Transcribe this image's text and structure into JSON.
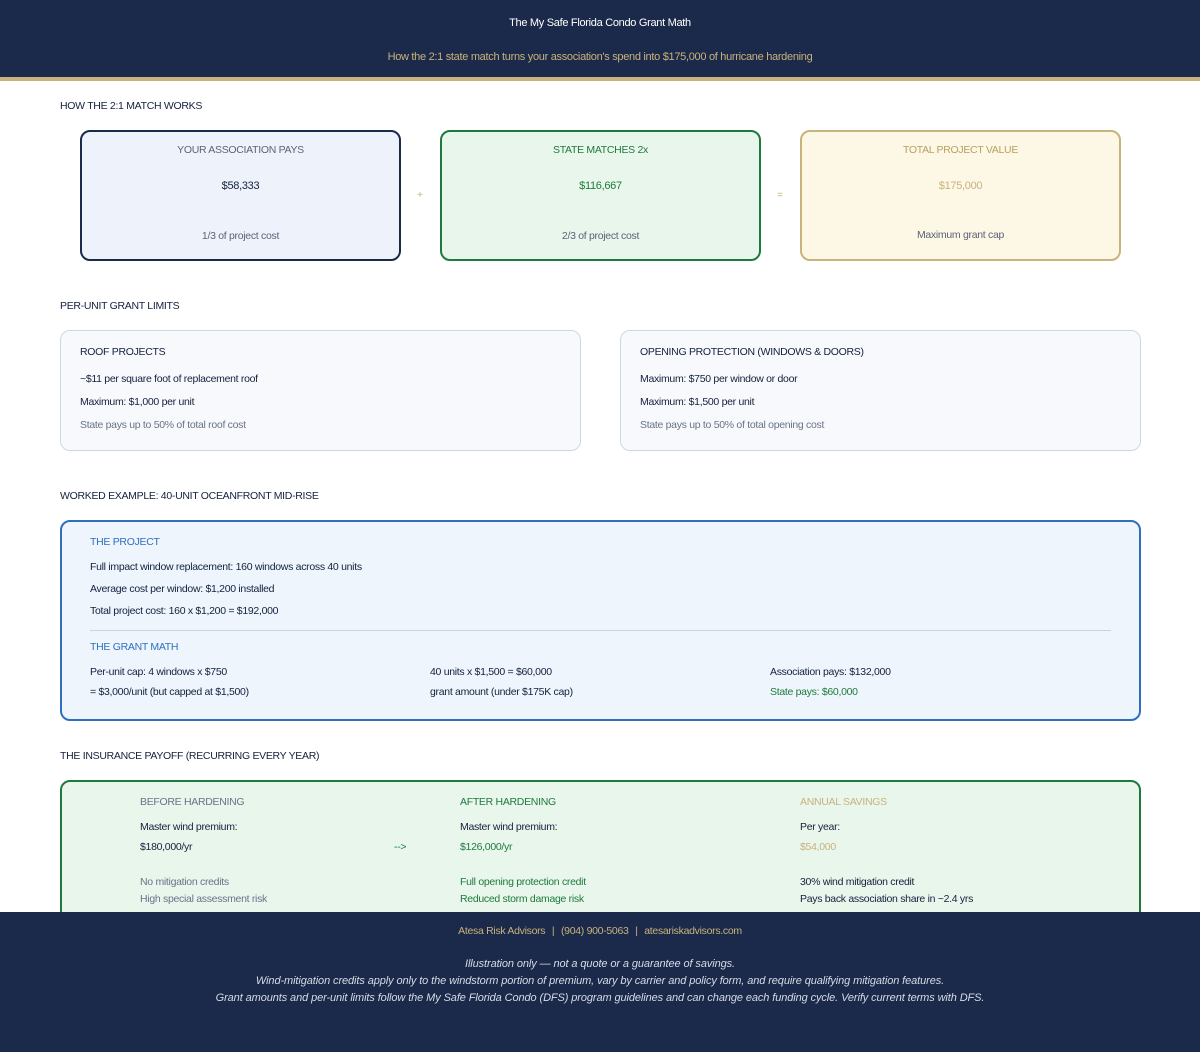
{
  "header": {
    "title": "The My Safe Florida Condo Grant Math",
    "subtitle": "How the 2:1 state match turns your association's spend into $175,000 of hurricane hardening"
  },
  "match": {
    "section_title": "HOW THE 2:1 MATCH WORKS",
    "plus": "+",
    "equals": "=",
    "association": {
      "label": "YOUR ASSOCIATION PAYS",
      "amount": "$58,333",
      "note": "1/3 of project cost"
    },
    "state": {
      "label": "STATE MATCHES 2x",
      "amount": "$116,667",
      "note": "2/3 of project cost"
    },
    "total": {
      "label": "TOTAL PROJECT VALUE",
      "amount": "$175,000",
      "note": "Maximum grant cap"
    }
  },
  "limits": {
    "section_title": "PER-UNIT GRANT LIMITS",
    "roof": {
      "title": "ROOF PROJECTS",
      "line1": "~$11 per square foot of replacement roof",
      "line2": "Maximum: $1,000 per unit",
      "note": "State pays up to 50% of total roof cost"
    },
    "opening": {
      "title": "OPENING PROTECTION (WINDOWS & DOORS)",
      "line1": "Maximum: $750 per window or door",
      "line2": "Maximum: $1,500 per unit",
      "note": "State pays up to 50% of total opening cost"
    }
  },
  "example": {
    "section_title": "WORKED EXAMPLE: 40-UNIT OCEANFRONT MID-RISE",
    "project_heading": "THE PROJECT",
    "project_lines": [
      "Full impact window replacement: 160 windows across 40 units",
      "Average cost per window: $1,200 installed",
      "Total project cost: 160 x $1,200 = $192,000"
    ],
    "math_heading": "THE GRANT MATH",
    "col1": [
      "Per-unit cap: 4 windows x $750",
      "= $3,000/unit (but capped at $1,500)"
    ],
    "col2": [
      "40 units x $1,500 = $60,000",
      "grant amount (under $175K cap)"
    ],
    "col3": [
      "Association pays: $132,000",
      "State pays: $60,000"
    ]
  },
  "insurance": {
    "section_title": "THE INSURANCE PAYOFF (RECURRING EVERY YEAR)",
    "arrow": "-->",
    "before": {
      "heading": "BEFORE HARDENING",
      "label": "Master wind premium:",
      "value": "$180,000/yr",
      "note1": "No mitigation credits",
      "note2": "High special assessment risk"
    },
    "after": {
      "heading": "AFTER HARDENING",
      "label": "Master wind premium:",
      "value": "$126,000/yr",
      "note1": "Full opening protection credit",
      "note2": "Reduced storm damage risk"
    },
    "savings": {
      "heading": "ANNUAL SAVINGS",
      "label": "Per year:",
      "value": "$54,000",
      "note1": "30% wind mitigation credit",
      "note2": "Pays back association share in ~2.4 yrs"
    }
  },
  "footer": {
    "company": "Atesa Risk Advisors",
    "phone": "(904) 900-5063",
    "website": "atesariskadvisors.com",
    "separator": "|",
    "disclaimer1": "Illustration only — not a quote or a guarantee of savings.",
    "disclaimer2": "Wind-mitigation credits apply only to the windstorm portion of premium, vary by carrier and policy form, and require qualifying mitigation features.",
    "disclaimer3": "Grant amounts and per-unit limits follow the My Safe Florida Condo (DFS) program guidelines and can change each funding cycle. Verify current terms with DFS."
  },
  "colors": {
    "navy": "#1b2a4a",
    "gold": "#c9b27c",
    "green": "#1f7a3d",
    "blue": "#2f6fc0"
  }
}
